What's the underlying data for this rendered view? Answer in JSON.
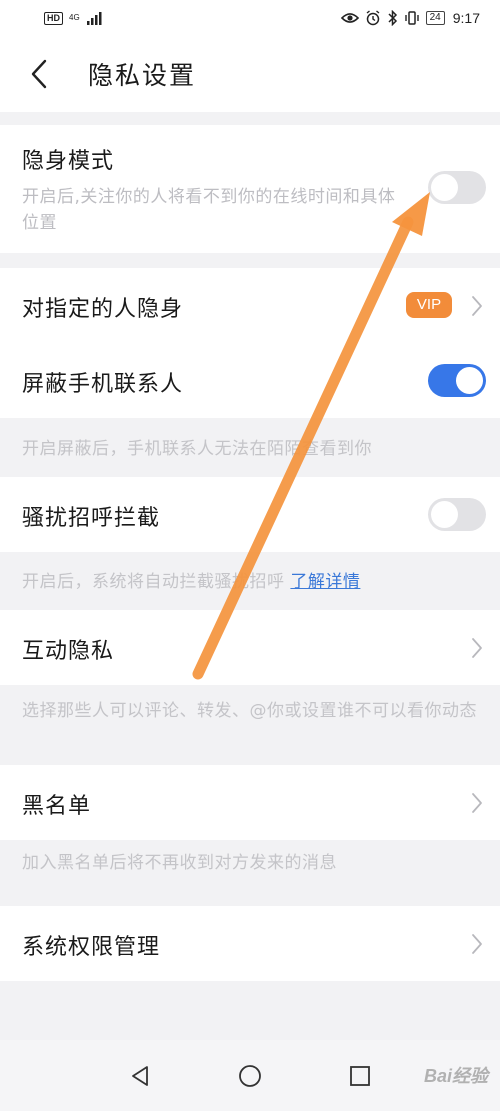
{
  "status_bar": {
    "hd": "HD",
    "network": "4G",
    "battery": "24",
    "time": "9:17"
  },
  "header": {
    "title": "隐私设置"
  },
  "settings": {
    "stealth": {
      "title": "隐身模式",
      "desc": "开启后,关注你的人将看不到你的在线时间和具体位置",
      "enabled": false
    },
    "hide_from_specific": {
      "title": "对指定的人隐身",
      "badge": "VIP"
    },
    "block_contacts": {
      "title": "屏蔽手机联系人",
      "enabled": true,
      "hint": "开启屏蔽后，手机联系人无法在陌陌查看到你"
    },
    "harassment": {
      "title": "骚扰招呼拦截",
      "enabled": false,
      "hint": "开启后，系统将自动拦截骚扰招呼",
      "link": "了解详情"
    },
    "interaction_privacy": {
      "title": "互动隐私",
      "hint": "选择那些人可以评论、转发、@你或设置谁不可以看你动态"
    },
    "blacklist": {
      "title": "黑名单",
      "hint": "加入黑名单后将不再收到对方发来的消息"
    },
    "permissions": {
      "title": "系统权限管理"
    }
  },
  "watermark": "Bai经验",
  "colors": {
    "toggle_on": "#3777e8",
    "toggle_off": "#e2e2e5",
    "vip": "#f28c3a",
    "link": "#3a78d8",
    "annotation_arrow": "#f5943d"
  }
}
